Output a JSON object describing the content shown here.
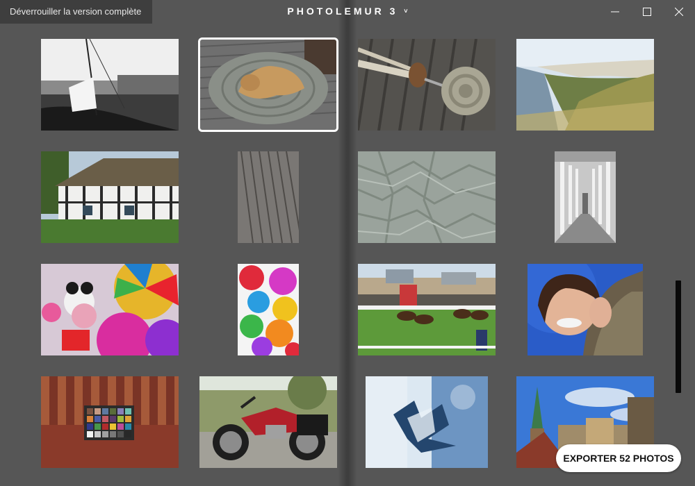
{
  "window": {
    "title": "PHOTOLEMUR 3",
    "title_chevron": "˅",
    "unlock_label": "Déverrouiller la version complète"
  },
  "export": {
    "label": "EXPORTER 52 PHOTOS"
  },
  "colors": {
    "background": "#565656",
    "selected_border": "#ffffff",
    "export_bg": "#ffffff"
  },
  "photos": [
    {
      "subject": "sailboat-harbor-bw",
      "selected": false
    },
    {
      "subject": "dog-on-rope-mat",
      "selected": true
    },
    {
      "subject": "ship-rope-pulley-knot",
      "selected": false
    },
    {
      "subject": "coastal-cliffs",
      "selected": false
    },
    {
      "subject": "half-timbered-cottage",
      "selected": false
    },
    {
      "subject": "wooden-deck-planks",
      "selected": false
    },
    {
      "subject": "crumpled-paper-texture",
      "selected": false
    },
    {
      "subject": "concrete-colonnade",
      "selected": false
    },
    {
      "subject": "colorful-pinwheels-mickey",
      "selected": false
    },
    {
      "subject": "colorful-pinwheels",
      "selected": false
    },
    {
      "subject": "horse-race",
      "selected": false
    },
    {
      "subject": "smiling-woman-portrait",
      "selected": false
    },
    {
      "subject": "color-checker-sofa",
      "selected": false
    },
    {
      "subject": "red-motorcycle",
      "selected": false
    },
    {
      "subject": "snowy-trees",
      "selected": false
    },
    {
      "subject": "church-spire-city",
      "selected": false
    }
  ]
}
